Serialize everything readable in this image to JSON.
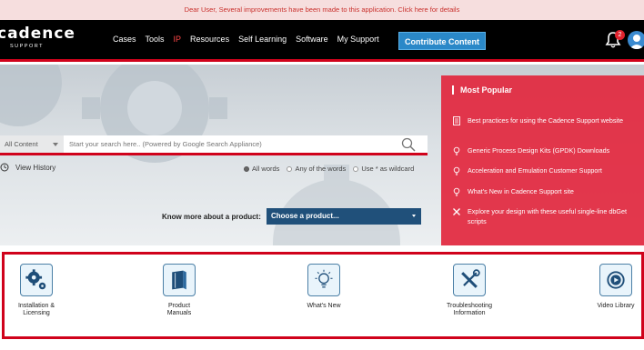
{
  "notice": {
    "text": "Dear User, Several improvements have been made to this application. ",
    "link": "Click here for details"
  },
  "header": {
    "brand": "cadence",
    "sub": "SUPPORT",
    "nav": [
      "Cases",
      "Tools",
      "IP",
      "Resources",
      "Self Learning",
      "Software",
      "My Support"
    ],
    "contribute": "Contribute Content",
    "notification_count": "2"
  },
  "search": {
    "scope": "All Content",
    "placeholder": "Start your search here.. (Powered by Google Search Appliance)",
    "history": "View History",
    "options": [
      "All words",
      "Any of the words",
      "Use * as wildcard"
    ],
    "selected_option": "All words"
  },
  "product": {
    "label": "Know more about a product:",
    "select": "Choose a product..."
  },
  "popular": {
    "title": "Most Popular",
    "items": [
      {
        "icon": "document-icon",
        "text": "Best practices for using the Cadence Support website"
      },
      {
        "icon": "lightbulb-icon",
        "text": "Generic Process Design Kits (GPDK) Downloads"
      },
      {
        "icon": "lightbulb-icon",
        "text": "Acceleration and Emulation Customer Support"
      },
      {
        "icon": "lightbulb-icon",
        "text": "What's New in Cadence Support site"
      },
      {
        "icon": "tools-icon",
        "text": "Explore your design with these useful single-line dbGet scripts"
      }
    ]
  },
  "quick_links": [
    {
      "icon": "gears-icon",
      "line1": "Installation &",
      "line2": "Licensing"
    },
    {
      "icon": "book-icon",
      "line1": "Product",
      "line2": "Manuals"
    },
    {
      "icon": "lightbulb-icon",
      "line1": "What's New",
      "line2": ""
    },
    {
      "icon": "wrench-screwdriver-icon",
      "line1": "Troubleshooting",
      "line2": "Information"
    },
    {
      "icon": "play-icon",
      "line1": "Video Library",
      "line2": ""
    }
  ],
  "colors": {
    "accent_red": "#d0021b",
    "header_bg": "#000000",
    "button_blue": "#2a88c8",
    "select_blue": "#20507a"
  }
}
